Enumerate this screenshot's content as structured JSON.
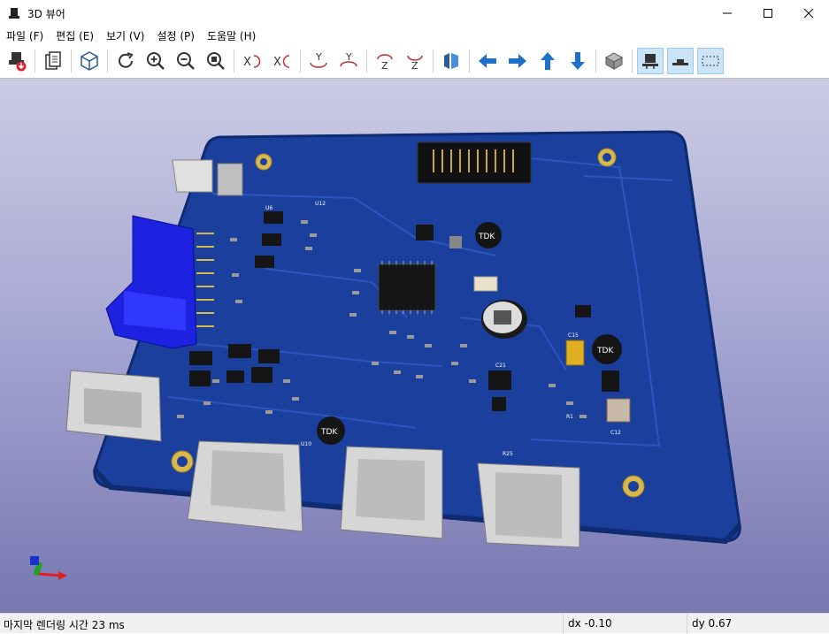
{
  "window": {
    "title": "3D 뷰어"
  },
  "menu": [
    "파일 (F)",
    "편집 (E)",
    "보기 (V)",
    "설정 (P)",
    "도움말 (H)"
  ],
  "toolbar": {
    "icons": [
      "render-raytrace-icon",
      "export-copy-icon",
      "toggle-3d-icon",
      "reload-icon",
      "zoom-in-icon",
      "zoom-out-icon",
      "zoom-fit-icon",
      "rotate-x-cw-icon",
      "rotate-x-ccw-icon",
      "rotate-y-cw-icon",
      "rotate-y-ccw-icon",
      "rotate-z-cw-icon",
      "rotate-z-ccw-icon",
      "flip-board-icon",
      "move-left-icon",
      "move-right-icon",
      "move-up-icon",
      "move-down-icon",
      "ortho-view-icon",
      "show-tht-icon",
      "show-smd-icon",
      "show-virtual-icon"
    ],
    "active": [
      "show-tht-icon",
      "show-smd-icon",
      "show-virtual-icon"
    ]
  },
  "board": {
    "silkscreen": [
      "TDK",
      "TDK",
      "TDK",
      "U12",
      "C21",
      "R25",
      "U6",
      "U10",
      "C15",
      "C12",
      "R1"
    ]
  },
  "status": {
    "render_time": "마지막 렌더링 시간 23 ms",
    "dx": "dx -0.10",
    "dy": "dy 0.67"
  },
  "colors": {
    "accent": "#0078d7",
    "board": "#1b3f9c",
    "pad_gold": "#d8b84a",
    "connector_blue": "#1c22e0"
  }
}
